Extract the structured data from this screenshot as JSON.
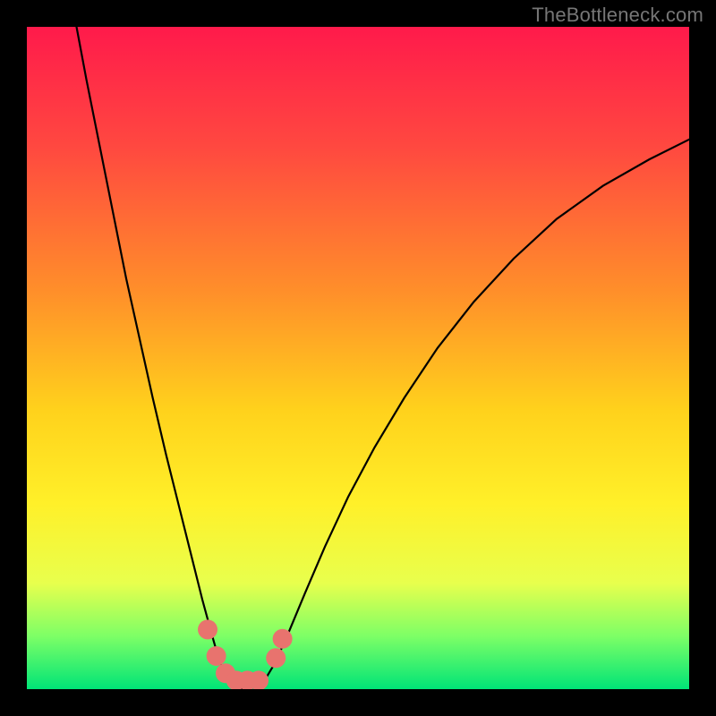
{
  "attribution": "TheBottleneck.com",
  "chart_data": {
    "type": "line",
    "title": "",
    "xlabel": "",
    "ylabel": "",
    "xlim": [
      0,
      100
    ],
    "ylim": [
      0,
      100
    ],
    "background_gradient": {
      "stops": [
        {
          "pct": 0,
          "color": "#ff1a4b"
        },
        {
          "pct": 18,
          "color": "#ff4840"
        },
        {
          "pct": 40,
          "color": "#ff8f2a"
        },
        {
          "pct": 58,
          "color": "#ffd21c"
        },
        {
          "pct": 72,
          "color": "#fff029"
        },
        {
          "pct": 84,
          "color": "#e8ff4d"
        },
        {
          "pct": 92,
          "color": "#7dff66"
        },
        {
          "pct": 100,
          "color": "#00e477"
        }
      ]
    },
    "series": [
      {
        "name": "bottleneck-curve",
        "type": "line",
        "color": "#000000",
        "width": 2.2,
        "points": [
          {
            "x": 7.5,
            "y": 100.0
          },
          {
            "x": 9.0,
            "y": 92.0
          },
          {
            "x": 11.0,
            "y": 82.0
          },
          {
            "x": 13.0,
            "y": 72.0
          },
          {
            "x": 15.0,
            "y": 62.0
          },
          {
            "x": 17.0,
            "y": 53.0
          },
          {
            "x": 19.0,
            "y": 44.0
          },
          {
            "x": 21.0,
            "y": 35.5
          },
          {
            "x": 23.0,
            "y": 27.5
          },
          {
            "x": 25.0,
            "y": 19.5
          },
          {
            "x": 26.5,
            "y": 13.5
          },
          {
            "x": 28.0,
            "y": 8.0
          },
          {
            "x": 29.0,
            "y": 4.5
          },
          {
            "x": 30.0,
            "y": 2.0
          },
          {
            "x": 31.5,
            "y": 0.4
          },
          {
            "x": 33.0,
            "y": 0.0
          },
          {
            "x": 34.5,
            "y": 0.3
          },
          {
            "x": 36.0,
            "y": 1.5
          },
          {
            "x": 37.5,
            "y": 4.0
          },
          {
            "x": 39.5,
            "y": 8.5
          },
          {
            "x": 42.0,
            "y": 14.5
          },
          {
            "x": 45.0,
            "y": 21.5
          },
          {
            "x": 48.5,
            "y": 29.0
          },
          {
            "x": 52.5,
            "y": 36.5
          },
          {
            "x": 57.0,
            "y": 44.0
          },
          {
            "x": 62.0,
            "y": 51.5
          },
          {
            "x": 67.5,
            "y": 58.5
          },
          {
            "x": 73.5,
            "y": 65.0
          },
          {
            "x": 80.0,
            "y": 71.0
          },
          {
            "x": 87.0,
            "y": 76.0
          },
          {
            "x": 94.0,
            "y": 80.0
          },
          {
            "x": 100.0,
            "y": 83.0
          }
        ]
      },
      {
        "name": "highlight-dots",
        "type": "scatter",
        "color": "#e8736e",
        "radius": 11,
        "points": [
          {
            "x": 27.3,
            "y": 9.0
          },
          {
            "x": 28.6,
            "y": 5.0
          },
          {
            "x": 30.0,
            "y": 2.4
          },
          {
            "x": 31.6,
            "y": 1.3
          },
          {
            "x": 33.3,
            "y": 1.3
          },
          {
            "x": 35.0,
            "y": 1.3
          },
          {
            "x": 37.6,
            "y": 4.7
          },
          {
            "x": 38.6,
            "y": 7.6
          }
        ]
      }
    ]
  }
}
